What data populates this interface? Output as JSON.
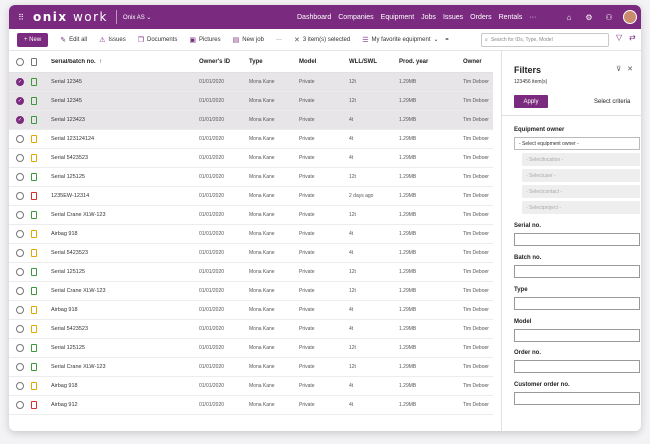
{
  "topbar": {
    "logo_bold": "onix",
    "logo_light": "work",
    "company": "Onix AS",
    "nav": [
      "Dashboard",
      "Companies",
      "Equipment",
      "Jobs",
      "Issues",
      "Orders",
      "Rentals"
    ],
    "more": "···",
    "brand_color": "#7b2b7f"
  },
  "toolbar": {
    "new_label": "New",
    "edit_label": "Edit all",
    "issues_label": "Issues",
    "documents_label": "Documents",
    "pictures_label": "Pictures",
    "newjob_label": "New job",
    "more": "···",
    "selected_label": "3 item(s) selected",
    "view_label": "My favorite equipment",
    "search_placeholder": "Search for IDs, Type, Model"
  },
  "table": {
    "headers": {
      "serial": "Serial/batch no.",
      "sort_icon": "↑",
      "owner_id": "Owner's ID",
      "type": "Type",
      "model": "Model",
      "wll": "WLL/SWL",
      "prod_year": "Prod. year",
      "owner": "Owner"
    },
    "rows": [
      {
        "selected": true,
        "doc": "green",
        "serial": "Serial 12345",
        "owner_id": "01/01/2020",
        "type": "Mona Kane",
        "model": "Private",
        "wll": "12t",
        "prod": "1.29MB",
        "owner": "Tim Deboer"
      },
      {
        "selected": true,
        "doc": "green",
        "serial": "Serial 12345",
        "owner_id": "01/01/2020",
        "type": "Mona Kane",
        "model": "Private",
        "wll": "12t",
        "prod": "1.29MB",
        "owner": "Tim Deboer"
      },
      {
        "selected": true,
        "doc": "green",
        "serial": "Serial 123423",
        "owner_id": "01/01/2020",
        "type": "Mona Kane",
        "model": "Private",
        "wll": "4t",
        "prod": "1.29MB",
        "owner": "Tim Deboer"
      },
      {
        "selected": false,
        "doc": "yellow",
        "serial": "Serial 123124124",
        "owner_id": "01/01/2020",
        "type": "Mona Kane",
        "model": "Private",
        "wll": "4t",
        "prod": "1.29MB",
        "owner": "Tim Deboer"
      },
      {
        "selected": false,
        "doc": "yellow",
        "serial": "Serial 5423523",
        "owner_id": "01/01/2020",
        "type": "Mona Kane",
        "model": "Private",
        "wll": "4t",
        "prod": "1.29MB",
        "owner": "Tim Deboer"
      },
      {
        "selected": false,
        "doc": "green",
        "serial": "Serial 125125",
        "owner_id": "01/01/2020",
        "type": "Mona Kane",
        "model": "Private",
        "wll": "12t",
        "prod": "1.29MB",
        "owner": "Tim Deboer"
      },
      {
        "selected": false,
        "doc": "red",
        "serial": "1235EW-12314",
        "owner_id": "01/01/2020",
        "type": "Mona Kane",
        "model": "Private",
        "wll": "2 days ago",
        "prod": "1.29MB",
        "owner": "Tim Deboer"
      },
      {
        "selected": false,
        "doc": "green",
        "serial": "Serial Crane XLW-123",
        "owner_id": "01/01/2020",
        "type": "Mona Kane",
        "model": "Private",
        "wll": "12t",
        "prod": "1.29MB",
        "owner": "Tim Deboer"
      },
      {
        "selected": false,
        "doc": "yellow",
        "serial": "Airbag 918",
        "owner_id": "01/01/2020",
        "type": "Mona Kane",
        "model": "Private",
        "wll": "4t",
        "prod": "1.29MB",
        "owner": "Tim Deboer"
      },
      {
        "selected": false,
        "doc": "yellow",
        "serial": "Serial 5423523",
        "owner_id": "01/01/2020",
        "type": "Mona Kane",
        "model": "Private",
        "wll": "4t",
        "prod": "1.29MB",
        "owner": "Tim Deboer"
      },
      {
        "selected": false,
        "doc": "green",
        "serial": "Serial 125125",
        "owner_id": "01/01/2020",
        "type": "Mona Kane",
        "model": "Private",
        "wll": "12t",
        "prod": "1.29MB",
        "owner": "Tim Deboer"
      },
      {
        "selected": false,
        "doc": "green",
        "serial": "Serial Crane XLW-123",
        "owner_id": "01/01/2020",
        "type": "Mona Kane",
        "model": "Private",
        "wll": "12t",
        "prod": "1.29MB",
        "owner": "Tim Deboer"
      },
      {
        "selected": false,
        "doc": "yellow",
        "serial": "Airbag 918",
        "owner_id": "01/01/2020",
        "type": "Mona Kane",
        "model": "Private",
        "wll": "4t",
        "prod": "1.29MB",
        "owner": "Tim Deboer"
      },
      {
        "selected": false,
        "doc": "yellow",
        "serial": "Serial 5423523",
        "owner_id": "01/01/2020",
        "type": "Mona Kane",
        "model": "Private",
        "wll": "4t",
        "prod": "1.29MB",
        "owner": "Tim Deboer"
      },
      {
        "selected": false,
        "doc": "green",
        "serial": "Serial 125125",
        "owner_id": "01/01/2020",
        "type": "Mona Kane",
        "model": "Private",
        "wll": "12t",
        "prod": "1.29MB",
        "owner": "Tim Deboer"
      },
      {
        "selected": false,
        "doc": "green",
        "serial": "Serial Crane XLW-123",
        "owner_id": "01/01/2020",
        "type": "Mona Kane",
        "model": "Private",
        "wll": "12t",
        "prod": "1.29MB",
        "owner": "Tim Deboer"
      },
      {
        "selected": false,
        "doc": "yellow",
        "serial": "Airbag 918",
        "owner_id": "01/01/2020",
        "type": "Mona Kane",
        "model": "Private",
        "wll": "4t",
        "prod": "1.29MB",
        "owner": "Tim Deboer"
      },
      {
        "selected": false,
        "doc": "red",
        "serial": "Airbag 912",
        "owner_id": "01/01/2020",
        "type": "Mona Kane",
        "model": "Private",
        "wll": "4t",
        "prod": "1.29MB",
        "owner": "Tim Deboer"
      }
    ]
  },
  "filters": {
    "title": "Filters",
    "count": "123456 item(s)",
    "apply_label": "Apply",
    "select_criteria": "Select criteria",
    "equipment_owner_label": "Equipment owner",
    "equipment_owner_placeholder": "- Select equipment owner -",
    "disabled_selects": [
      "- Selectlocation -",
      "- Selectuser -",
      "- Selectcontact -",
      "- Selectproject -"
    ],
    "serial_label": "Serial no.",
    "batch_label": "Batch no.",
    "type_label": "Type",
    "model_label": "Model",
    "order_label": "Order no.",
    "customer_order_label": "Customer order no."
  }
}
